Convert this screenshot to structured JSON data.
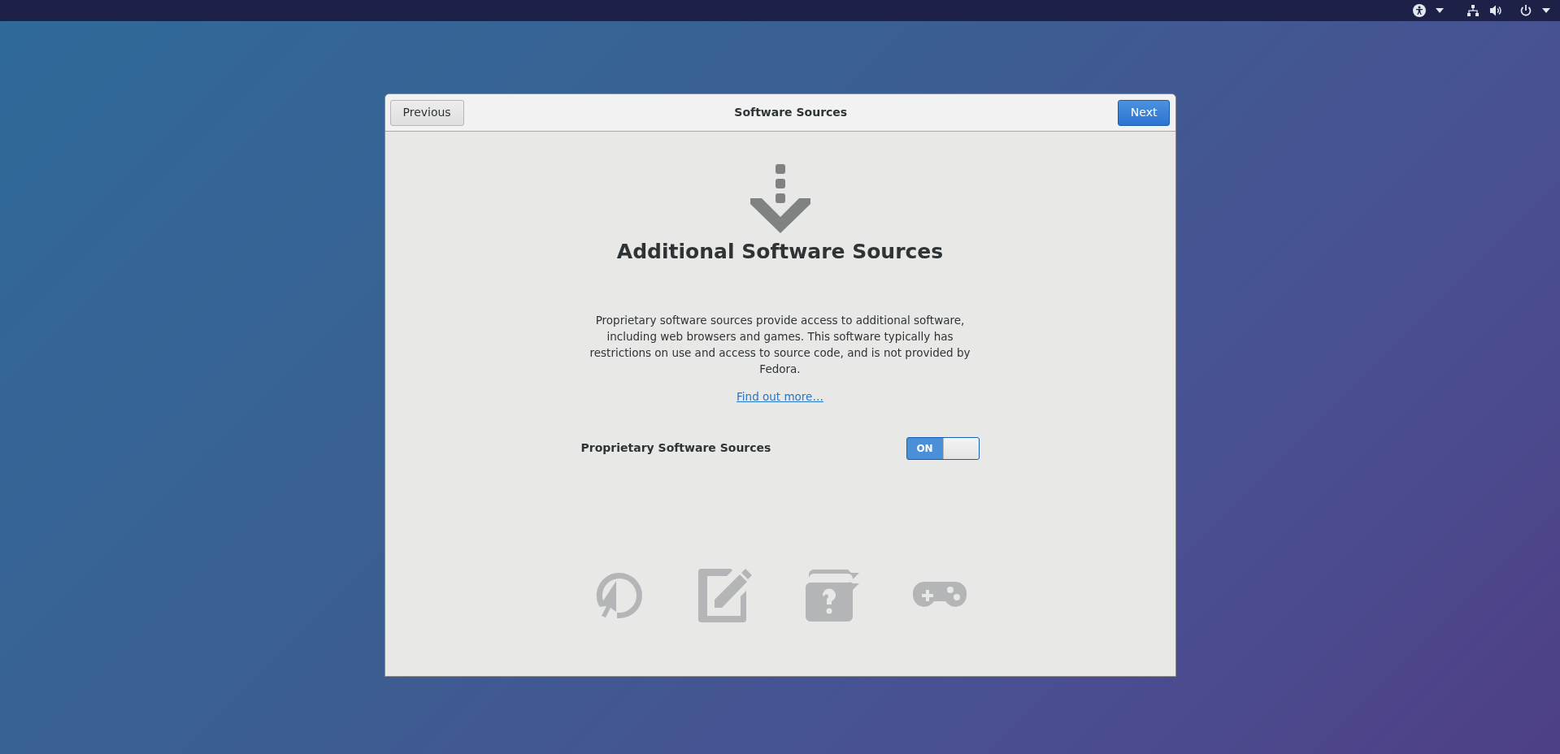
{
  "dialog": {
    "title": "Software Sources",
    "previous_button": "Previous",
    "next_button": "Next"
  },
  "content": {
    "heading": "Additional Software Sources",
    "description": "Proprietary software sources provide access to additional software, including web browsers and games. This software typically has restrictions on use and access to source code, and is not provided by Fedora.",
    "link": "Find out more…"
  },
  "switch": {
    "label": "Proprietary Software Sources",
    "on": true,
    "on_text": "ON"
  }
}
